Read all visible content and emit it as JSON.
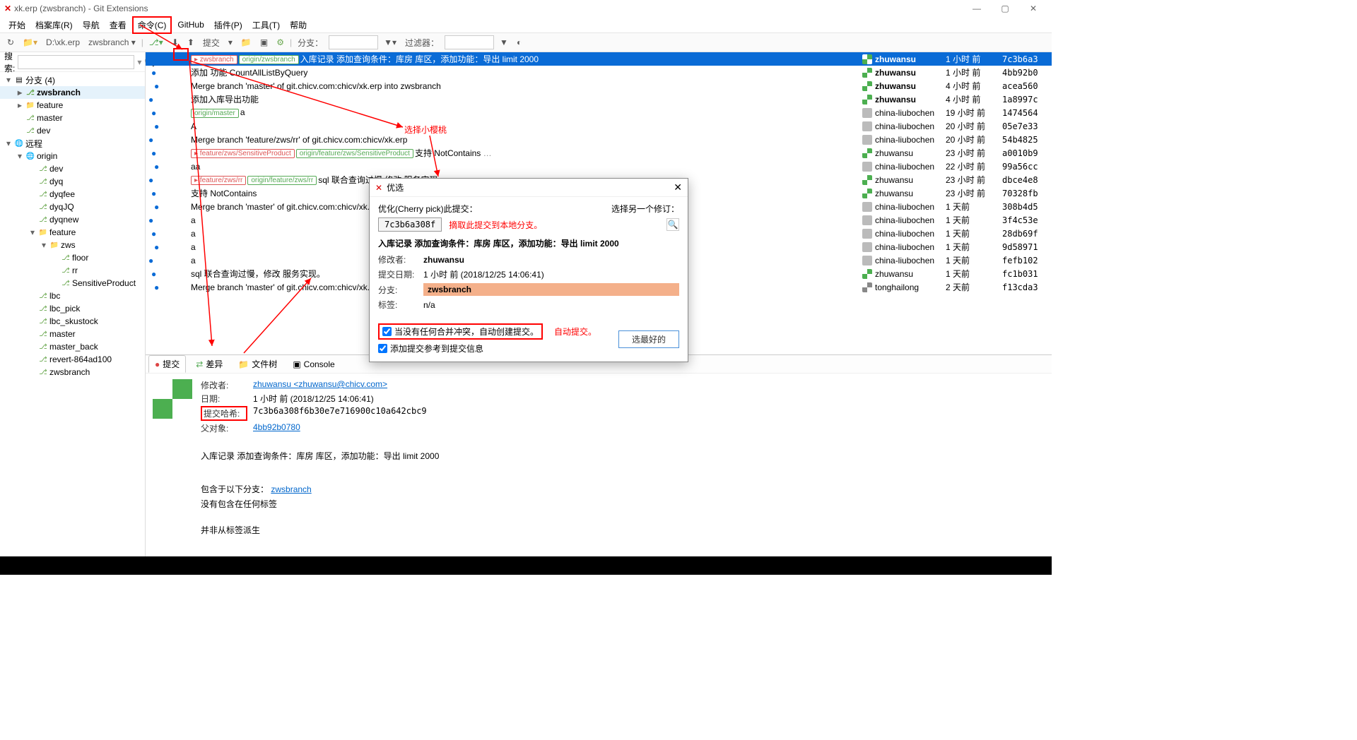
{
  "window": {
    "title": "xk.erp (zwsbranch) - Git Extensions"
  },
  "menubar": [
    "开始",
    "档案库(R)",
    "导航",
    "查看",
    "命令(C)",
    "GitHub",
    "插件(P)",
    "工具(T)",
    "帮助"
  ],
  "toolbar": {
    "path": "D:\\xk.erp",
    "branch": "zwsbranch",
    "commit_label": "提交",
    "branch_label": "分支：",
    "filter_label": "过滤器："
  },
  "search_label": "搜索:",
  "tree": {
    "branches_header": "分支 (4)",
    "local": [
      "zwsbranch",
      "feature",
      "master",
      "dev"
    ],
    "remote_header": "远程",
    "origin": "origin",
    "origin_children": [
      "dev",
      "dyq",
      "dyqfee",
      "dyqJQ",
      "dyqnew"
    ],
    "feature": "feature",
    "zws": "zws",
    "zws_children": [
      "floor",
      "rr",
      "SensitiveProduct"
    ],
    "origin_tail": [
      "lbc",
      "lbc_pick",
      "lbc_skustock",
      "master",
      "master_back",
      "revert-864ad100",
      "zwsbranch"
    ]
  },
  "commits": [
    {
      "refs": [
        {
          "t": "local",
          "n": "zwsbranch"
        },
        {
          "t": "remote",
          "n": "origin/zwsbranch"
        }
      ],
      "msg": "入库记录 添加查询条件：库房 库区，添加功能：导出 limit 2000",
      "author": "zhuwansu",
      "time": "1 小时 前",
      "hash": "7c3b6a3",
      "sel": true,
      "av": "g"
    },
    {
      "msg": "添加 功能 CountAllListByQuery",
      "author": "zhuwansu",
      "time": "1 小时 前",
      "hash": "4bb92b0",
      "av": "g"
    },
    {
      "msg": "Merge branch 'master' of git.chicv.com:chicv/xk.erp into zwsbranch",
      "author": "zhuwansu",
      "time": "4 小时 前",
      "hash": "acea560",
      "av": "g"
    },
    {
      "msg": "添加入库导出功能",
      "author": "zhuwansu",
      "time": "4 小时 前",
      "hash": "1a8997c",
      "av": "g"
    },
    {
      "refs": [
        {
          "t": "remote",
          "n": "origin/master"
        }
      ],
      "msg": "a",
      "author": "china-liubochen",
      "time": "19 小时 前",
      "hash": "1474564",
      "av": "x"
    },
    {
      "msg": "A",
      "author": "china-liubochen",
      "time": "20 小时 前",
      "hash": "05e7e33",
      "av": "x"
    },
    {
      "msg": "Merge branch 'feature/zws/rr' of git.chicv.com:chicv/xk.erp",
      "author": "china-liubochen",
      "time": "20 小时 前",
      "hash": "54b4825",
      "av": "x"
    },
    {
      "refs": [
        {
          "t": "local",
          "n": "feature/zws/SensitiveProduct"
        },
        {
          "t": "remote",
          "n": "origin/feature/zws/SensitiveProduct"
        }
      ],
      "msg": "支持 NotContains",
      "author": "zhuwansu",
      "time": "23 小时 前",
      "hash": "a0010b9",
      "av": "g",
      "ell": true
    },
    {
      "msg": "aa",
      "author": "china-liubochen",
      "time": "22 小时 前",
      "hash": "99a56cc",
      "av": "x"
    },
    {
      "refs": [
        {
          "t": "local",
          "n": "feature/zws/rr"
        },
        {
          "t": "remote",
          "n": "origin/feature/zws/rr"
        }
      ],
      "msg": "sql 联合查询过慢  修改 服务实现",
      "author": "zhuwansu",
      "time": "23 小时 前",
      "hash": "dbce4e8",
      "av": "g"
    },
    {
      "msg": "支持 NotContains",
      "author": "zhuwansu",
      "time": "23 小时 前",
      "hash": "70328fb",
      "av": "g"
    },
    {
      "msg": "Merge branch 'master' of git.chicv.com:chicv/xk.erp",
      "author": "china-liubochen",
      "time": "1 天前",
      "hash": "308b4d5",
      "av": "x"
    },
    {
      "msg": "a",
      "author": "china-liubochen",
      "time": "1 天前",
      "hash": "3f4c53e",
      "av": "x"
    },
    {
      "msg": "a",
      "author": "china-liubochen",
      "time": "1 天前",
      "hash": "28db69f",
      "av": "x"
    },
    {
      "msg": "a",
      "author": "china-liubochen",
      "time": "1 天前",
      "hash": "9d58971",
      "av": "x"
    },
    {
      "msg": "a",
      "author": "china-liubochen",
      "time": "1 天前",
      "hash": "fefb102",
      "av": "x"
    },
    {
      "msg": "sql 联合查询过慢，修改 服务实现。",
      "author": "zhuwansu",
      "time": "1 天前",
      "hash": "fc1b031",
      "av": "g"
    },
    {
      "msg": "Merge branch 'master' of git.chicv.com:chicv/xk.erp",
      "author": "tonghailong",
      "time": "2 天前",
      "hash": "f13cda3",
      "av": "a"
    }
  ],
  "bottom_tabs": [
    "提交",
    "差异",
    "文件树",
    "Console"
  ],
  "detail": {
    "author_label": "修改者:",
    "author_link": "zhuwansu <zhuwansu@chicv.com>",
    "date_label": "日期:",
    "date": "1 小时 前 (2018/12/25 14:06:41)",
    "hash_label": "提交哈希:",
    "hash": "7c3b6a308f6b30e7e716900c10a642cbc9",
    "parent_label": "父对象:",
    "parent_link": "4bb92b0780",
    "message": "入库记录 添加查询条件：库房 库区，添加功能：导出 limit 2000",
    "contained_prefix": "包含于以下分支：",
    "contained_branch": "zwsbranch",
    "no_tags": "没有包含在任何标签",
    "not_from_tag": "并非从标签派生"
  },
  "dialog": {
    "title": "优选",
    "subtitle": "优化(Cherry pick)此提交：",
    "hash": "7c3b6a308f",
    "pick_another": "选择另一个修订：",
    "msg": "入库记录 添加查询条件：库房 库区，添加功能：导出 limit 2000",
    "f_author": "修改者:",
    "v_author": "zhuwansu",
    "f_date": "提交日期:",
    "v_date": "1 小时 前 (2018/12/25 14:06:41)",
    "f_branch": "分支:",
    "v_branch": "zwsbranch",
    "f_tag": "标签:",
    "v_tag": "n/a",
    "cb1": "当没有任何合并冲突，自动创建提交。",
    "cb2": "添加提交参考到提交信息",
    "ok": "选最好的"
  },
  "annotations": {
    "a1": "选择小樱桃",
    "a2": "摘取此提交到本地分支。",
    "a3": "自动提交。"
  }
}
